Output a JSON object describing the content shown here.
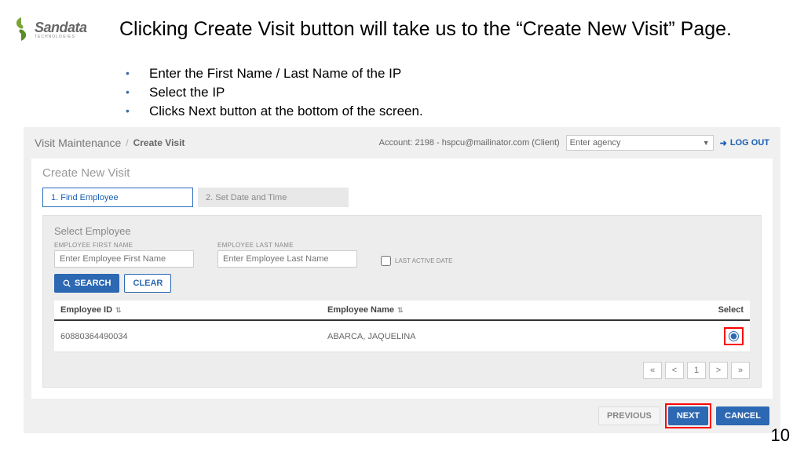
{
  "logo": {
    "brand": "Sandata",
    "sub": "TECHNOLOGIES"
  },
  "heading": "Clicking Create Visit button will take us to the “Create New Visit” Page.",
  "bullets": [
    "Enter the First Name / Last Name of the IP",
    "Select the IP",
    "Clicks Next button at the bottom of the screen."
  ],
  "breadcrumb": {
    "main": "Visit Maintenance",
    "current": "Create Visit"
  },
  "account_text": "Account: 2198 - hspcu@mailinator.com (Client)",
  "agency_placeholder": "Enter agency",
  "logout": "LOG OUT",
  "card_title": "Create New Visit",
  "steps": {
    "s1": "1. Find Employee",
    "s2": "2. Set Date and Time"
  },
  "panel": {
    "title": "Select Employee",
    "first_label": "EMPLOYEE FIRST NAME",
    "first_ph": "Enter Employee First Name",
    "last_label": "EMPLOYEE LAST NAME",
    "last_ph": "Enter Employee Last Name",
    "last_active": "LAST ACTIVE DATE",
    "search": "SEARCH",
    "clear": "CLEAR"
  },
  "table": {
    "col_id": "Employee ID",
    "col_name": "Employee Name",
    "col_select": "Select",
    "row": {
      "id": "60880364490034",
      "name": "ABARCA, JAQUELINA"
    }
  },
  "pager": {
    "first": "«",
    "prev": "<",
    "page": "1",
    "next": ">",
    "last": "»"
  },
  "footer": {
    "previous": "PREVIOUS",
    "next": "NEXT",
    "cancel": "CANCEL"
  },
  "page_number": "10"
}
